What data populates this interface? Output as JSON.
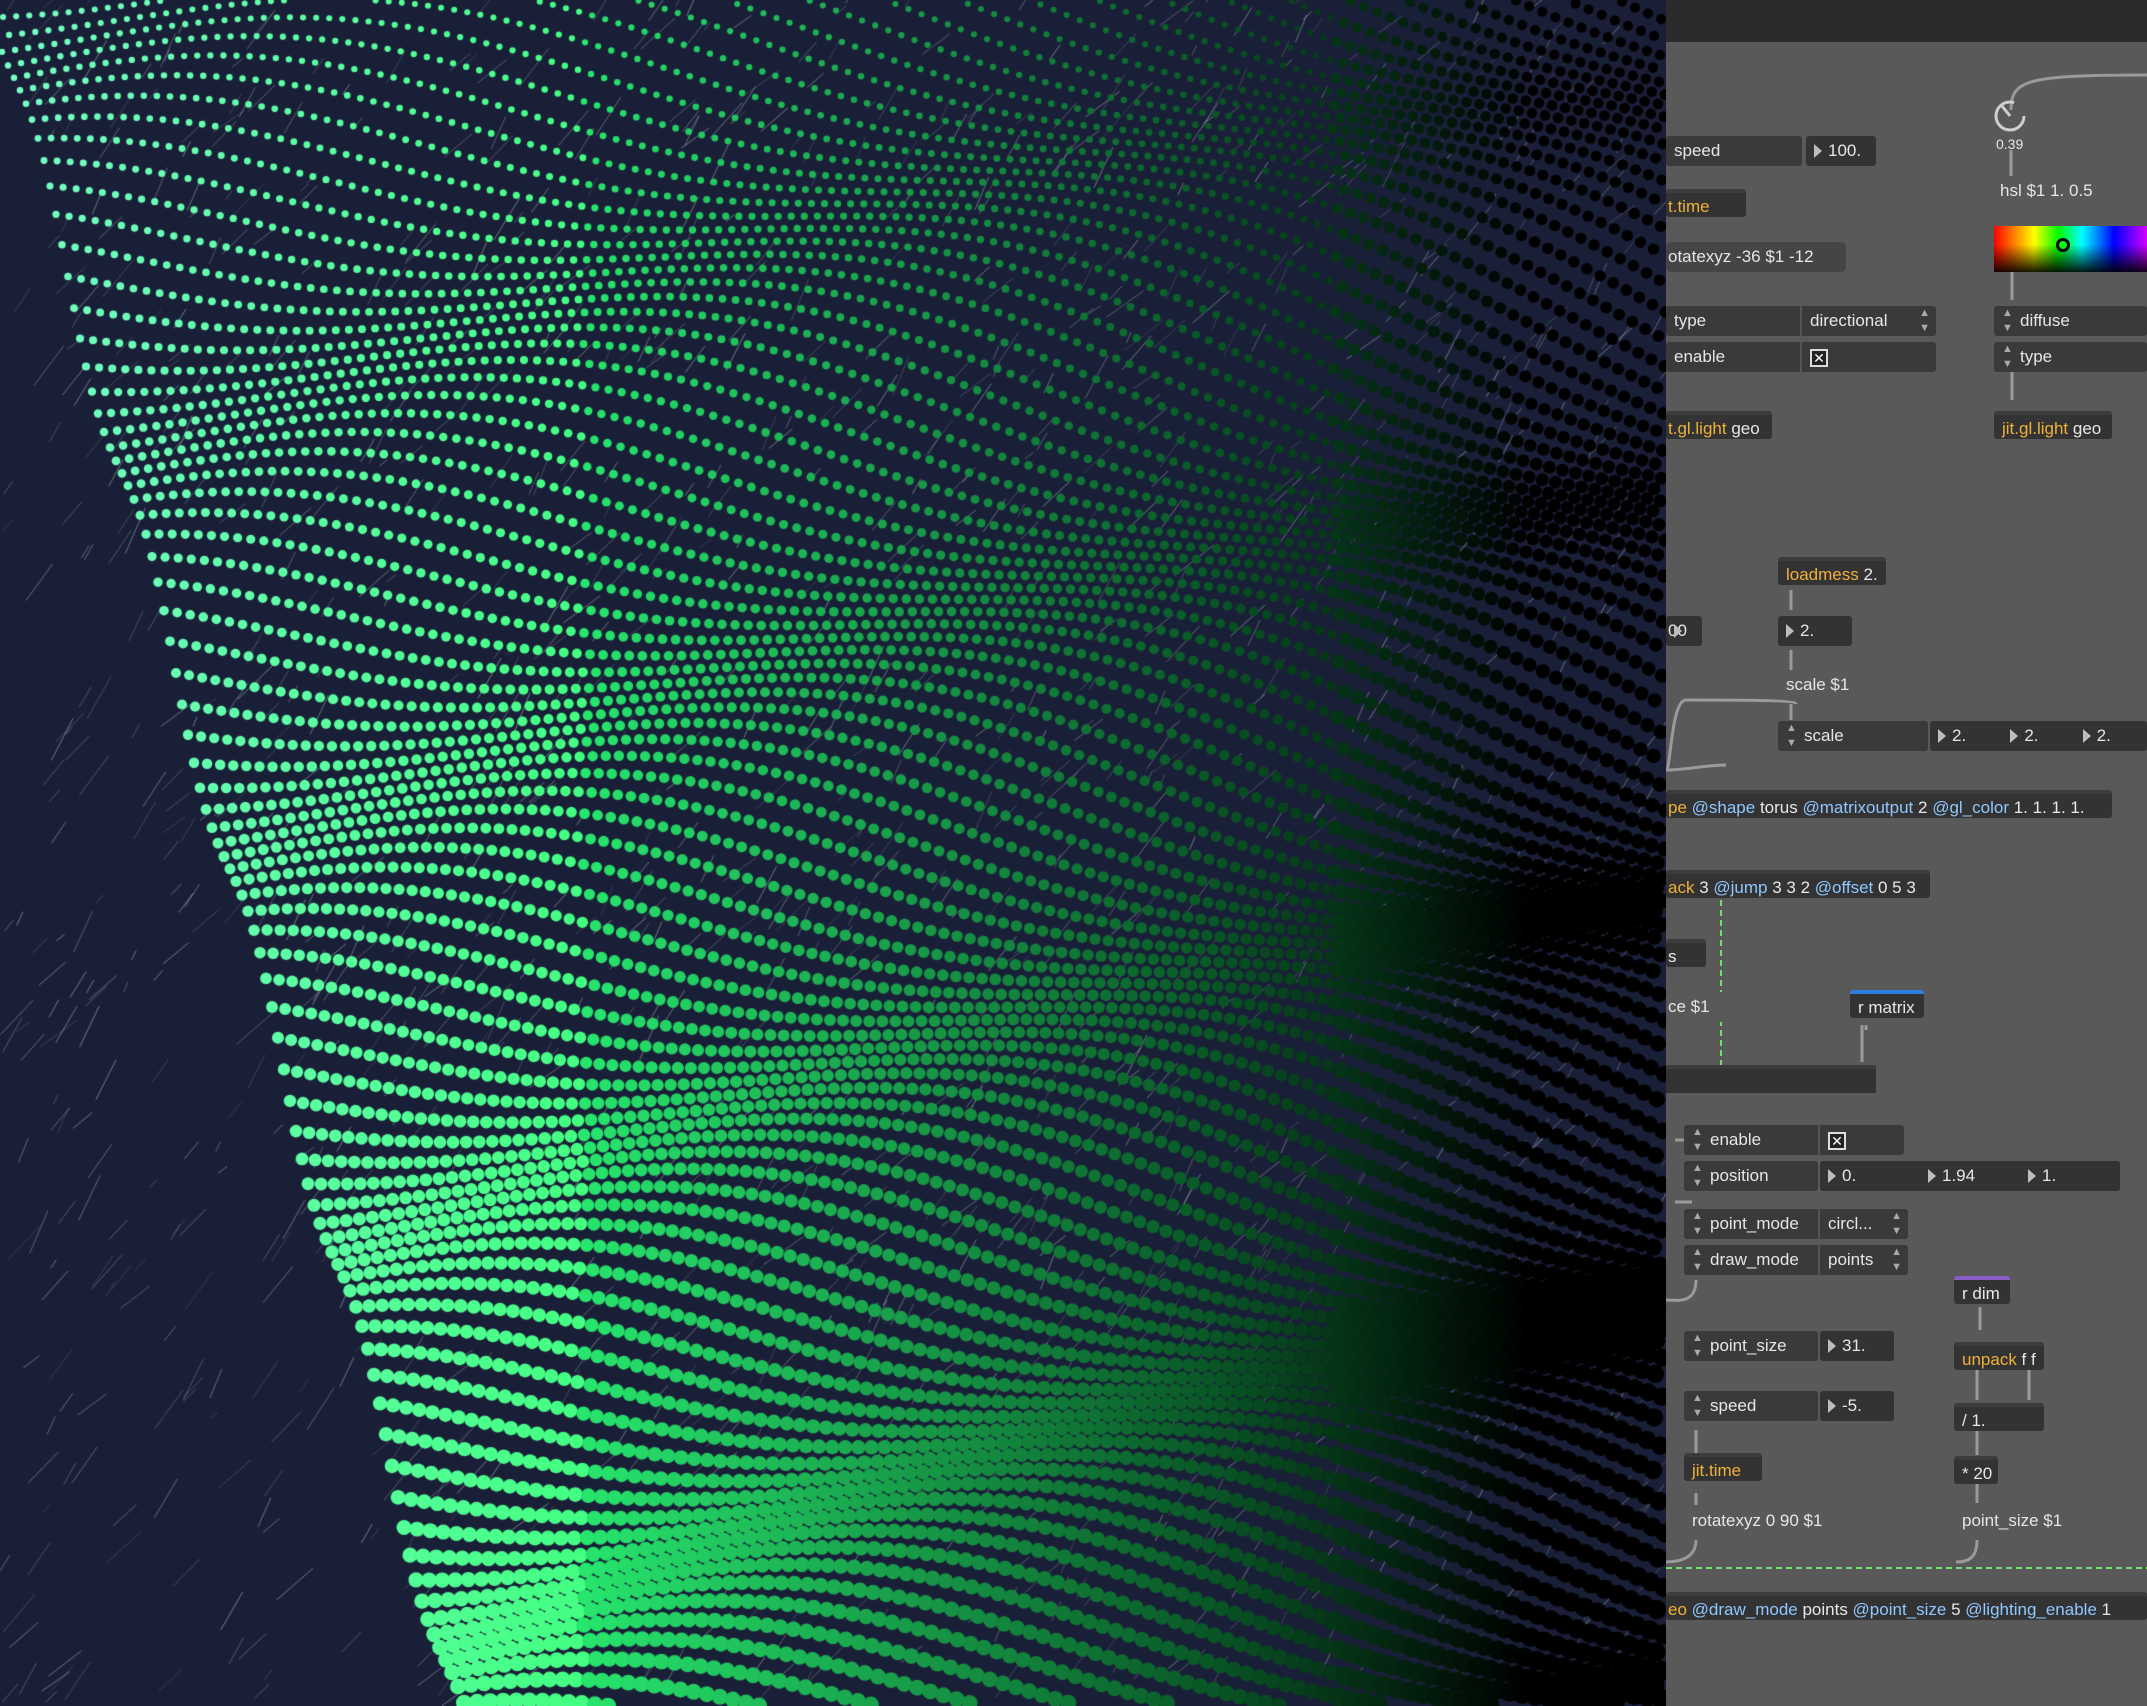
{
  "colors": {
    "viewport_bg": "#1a1f38",
    "patcher_bg": "#595959",
    "object_bg": "#333333",
    "jit_text": "#f0b13a",
    "attr_text": "#8fc7ff",
    "patch_cord": "#9a9a9a",
    "matrix_cord": "#6ee06e",
    "send_bar": "#2f7fe0",
    "recv_bar": "#8a5cc8"
  },
  "patcher": {
    "speed_top": {
      "name": "speed",
      "value": "100."
    },
    "time_top": "t.time",
    "rotate_top": "otatexyz -36 $1 -12",
    "light_left_type": {
      "name": "type",
      "value": "directional"
    },
    "light_left_enable": {
      "name": "enable",
      "value": "✕"
    },
    "light_left_obj": {
      "prefix": "t.gl.light",
      "suffix": " geo"
    },
    "dial_value": "0.39",
    "hsl_msg": "hsl $1 1. 0.5",
    "light_right_diffuse": {
      "name": "diffuse"
    },
    "light_right_type": {
      "name": "type"
    },
    "light_right_obj": {
      "prefix": "jit.gl.light",
      "suffix": " geo"
    },
    "loadmess": {
      "name": "loadmess",
      "arg": " 2."
    },
    "left_partial_num": "00",
    "scale_num": "2.",
    "scale_msg": "scale $1",
    "scale_attr": {
      "name": "scale",
      "v1": "2.",
      "v2": "2.",
      "v3": "2."
    },
    "gridshape": {
      "p1": "pe ",
      "a1": "@shape",
      "v1": " torus ",
      "a2": "@matrixoutput",
      "v2": " 2 ",
      "a3": "@gl_color",
      "v3": " 1. 1. 1. 1."
    },
    "scissors": {
      "p1": "ack",
      "v1": " 3 ",
      "a1": "@jump",
      "v2": " 3 3 2 ",
      "a2": "@offset",
      "v3": " 0 5 3"
    },
    "partial_s": "s",
    "ce_msg": "ce $1",
    "r_matrix": "r matrix",
    "enable_attr": {
      "name": "enable",
      "value": "✕"
    },
    "position_attr": {
      "name": "position",
      "v1": "0.",
      "v2": "1.94",
      "v3": "1."
    },
    "point_mode": {
      "name": "point_mode",
      "value": "circl..."
    },
    "draw_mode": {
      "name": "draw_mode",
      "value": "points"
    },
    "r_dim": "r dim",
    "unpack": {
      "name": "unpack",
      "args": " f f"
    },
    "point_size": {
      "name": "point_size",
      "value": "31."
    },
    "speed_bottom": {
      "name": "speed",
      "value": "-5."
    },
    "div": "/ 1.",
    "jit_time": "jit.time",
    "mul": "* 20",
    "rotate_bottom": "rotatexyz 0 90 $1",
    "point_size_msg": "point_size $1",
    "mesh": {
      "p1": "eo ",
      "a1": "@draw_mode",
      "v1": " points ",
      "a2": "@point_size",
      "v2": " 5 ",
      "a3": "@lighting_enable",
      "v3": " 1"
    }
  }
}
